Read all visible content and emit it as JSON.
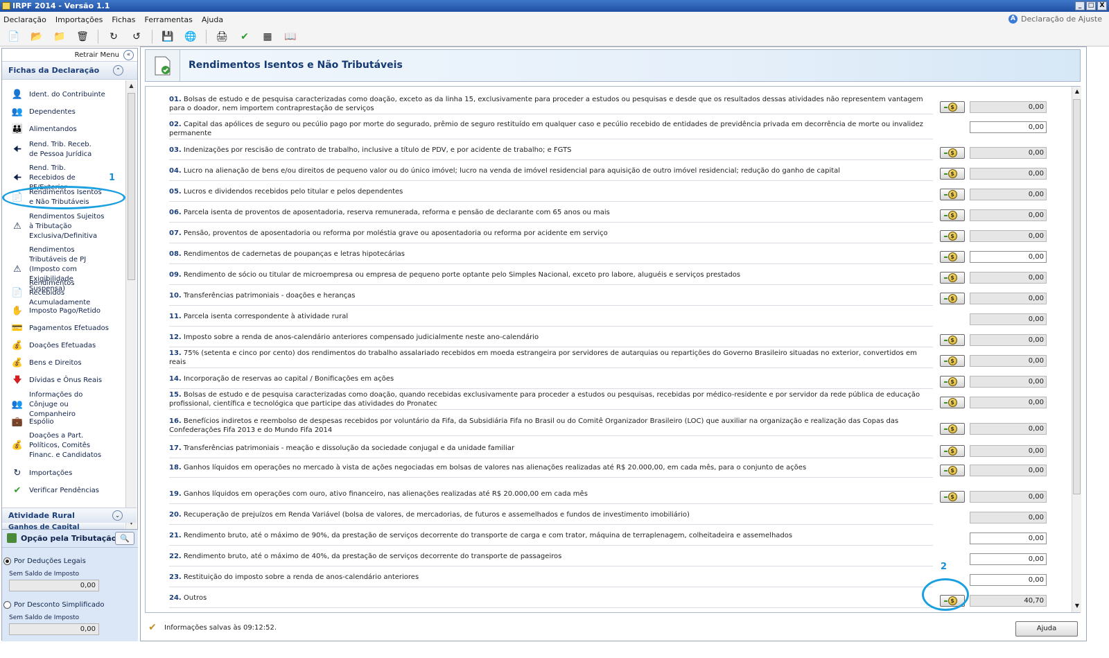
{
  "window": {
    "title": "IRPF 2014 - Versão 1.1",
    "buttons": [
      "_",
      "□",
      "X"
    ]
  },
  "menu": [
    "Declaração",
    "Importações",
    "Fichas",
    "Ferramentas",
    "Ajuda"
  ],
  "decl_type": "Declaração de Ajuste",
  "sidebar": {
    "retrair": "Retrair Menu",
    "fichas_title": "Fichas da Declaração",
    "items": [
      {
        "label": "Ident. do Contribuinte",
        "icon": "person-icon"
      },
      {
        "label": "Dependentes",
        "icon": "dependents-icon"
      },
      {
        "label": "Alimentandos",
        "icon": "alimentandos-icon"
      },
      {
        "label": "Rend. Trib. Receb. de Pessoa Jurídica",
        "icon": "income-pj-icon"
      },
      {
        "label": "Rend. Trib. Recebidos de PF/Exterior",
        "icon": "income-pf-icon"
      },
      {
        "label": "Rendimentos Isentos e Não Tributáveis",
        "icon": "exempt-income-icon"
      },
      {
        "label": "Rendimentos Sujeitos à Tributação Exclusiva/Definitiva",
        "icon": "exclusive-tax-icon"
      },
      {
        "label": "Rendimentos Tributáveis de PJ (Imposto com Exigibilidade Suspensa)",
        "icon": "suspended-tax-icon"
      },
      {
        "label": "Rendimentos Recebidos Acumuladamente",
        "icon": "accumulated-income-icon"
      },
      {
        "label": "Imposto Pago/Retido",
        "icon": "tax-paid-icon"
      },
      {
        "label": "Pagamentos Efetuados",
        "icon": "payments-icon"
      },
      {
        "label": "Doações Efetuadas",
        "icon": "donations-icon"
      },
      {
        "label": "Bens e Direitos",
        "icon": "assets-icon"
      },
      {
        "label": "Dívidas e Ônus Reais",
        "icon": "debts-icon"
      },
      {
        "label": "Informações do Cônjuge ou Companheiro",
        "icon": "spouse-icon"
      },
      {
        "label": "Espólio",
        "icon": "estate-icon"
      },
      {
        "label": "Doações a Part. Políticos, Comitês Financ. e Candidatos",
        "icon": "political-donations-icon"
      },
      {
        "label": "Importações",
        "icon": "import-icon"
      },
      {
        "label": "Verificar Pendências",
        "icon": "check-icon"
      }
    ],
    "atividade_rural": "Atividade Rural",
    "ganhos": "Ganhos de Capital",
    "opcao_title": "Opção pela Tributação:",
    "deducoes_label": "Por Deduções Legais",
    "deducoes_sub": "Sem Saldo de Imposto",
    "deducoes_value": "0,00",
    "simplificado_label": "Por Desconto Simplificado",
    "simplificado_sub": "Sem Saldo de Imposto",
    "simplificado_value": "0,00"
  },
  "main": {
    "title": "Rendimentos Isentos e Não Tributáveis",
    "rows": [
      {
        "num": "01.",
        "text": "Bolsas de estudo e de pesquisa caracterizadas como doação, exceto as da linha 15, exclusivamente para proceder a estudos ou pesquisas e desde que os resultados dessas atividades não representem vantagem para o doador, nem importem contraprestação de serviços",
        "btn": true,
        "value": "0,00",
        "editable": false
      },
      {
        "num": "02.",
        "text": "Capital das apólices de seguro ou pecúlio pago por morte do segurado, prêmio de seguro restituído em qualquer caso e pecúlio recebido de entidades de previdência privada em decorrência de morte ou invalidez permanente",
        "btn": false,
        "value": "0,00",
        "editable": true
      },
      {
        "num": "03.",
        "text": "Indenizações por rescisão de contrato de trabalho, inclusive a título de PDV, e por acidente de trabalho; e FGTS",
        "btn": true,
        "value": "0,00",
        "editable": false
      },
      {
        "num": "04.",
        "text": "Lucro na alienação de bens e/ou direitos de pequeno valor ou do único imóvel; lucro na venda de imóvel residencial para aquisição de outro imóvel residencial; redução do ganho de capital",
        "btn": true,
        "value": "0,00",
        "editable": false
      },
      {
        "num": "05.",
        "text": "Lucros e dividendos recebidos pelo titular e pelos dependentes",
        "btn": true,
        "value": "0,00",
        "editable": false
      },
      {
        "num": "06.",
        "text": "Parcela isenta de proventos de aposentadoria, reserva remunerada, reforma e pensão de declarante com 65 anos ou mais",
        "btn": true,
        "value": "0,00",
        "editable": false
      },
      {
        "num": "07.",
        "text": "Pensão, proventos de aposentadoria ou reforma por moléstia grave ou aposentadoria ou reforma por acidente em serviço",
        "btn": true,
        "value": "0,00",
        "editable": false
      },
      {
        "num": "08.",
        "text": "Rendimentos de cadernetas de poupanças e letras hipotecárias",
        "btn": true,
        "value": "0,00",
        "editable": true
      },
      {
        "num": "09.",
        "text": "Rendimento de sócio ou titular de microempresa ou empresa de pequeno porte optante pelo Simples Nacional, exceto pro labore, aluguéis e serviços prestados",
        "btn": true,
        "value": "0,00",
        "editable": false
      },
      {
        "num": "10.",
        "text": "Transferências patrimoniais - doações e heranças",
        "btn": true,
        "value": "0,00",
        "editable": false
      },
      {
        "num": "11.",
        "text": "Parcela isenta correspondente à atividade rural",
        "btn": false,
        "value": "0,00",
        "editable": false
      },
      {
        "num": "12.",
        "text": "Imposto sobre a renda de anos-calendário anteriores compensado judicialmente neste ano-calendário",
        "btn": true,
        "value": "0,00",
        "editable": false
      },
      {
        "num": "13.",
        "text": "75% (setenta e cinco por cento) dos rendimentos do trabalho assalariado recebidos em moeda estrangeira por servidores de autarquias ou repartições do Governo Brasileiro situadas no exterior, convertidos em reais",
        "btn": true,
        "value": "0,00",
        "editable": false
      },
      {
        "num": "14.",
        "text": "Incorporação de reservas ao capital / Bonificações em ações",
        "btn": true,
        "value": "0,00",
        "editable": false
      },
      {
        "num": "15.",
        "text": "Bolsas de estudo e de pesquisa caracterizadas como doação, quando recebidas exclusivamente para proceder a estudos ou pesquisas, recebidas por médico-residente e por servidor da rede pública de educação profissional, científica e tecnológica que participe das atividades do Pronatec",
        "btn": true,
        "value": "0,00",
        "editable": false
      },
      {
        "num": "16.",
        "text": "Benefícios indiretos e reembolso de despesas recebidos por voluntário da Fifa, da Subsidiária Fifa no Brasil ou do Comitê Organizador Brasileiro (LOC) que auxiliar na organização e realização das Copas das Confederações Fifa 2013 e do Mundo Fifa 2014",
        "btn": true,
        "value": "0,00",
        "editable": false
      },
      {
        "num": "17.",
        "text": "Transferências patrimoniais - meação e dissolução da sociedade conjugal e da unidade familiar",
        "btn": true,
        "value": "0,00",
        "editable": false
      },
      {
        "num": "18.",
        "text": "Ganhos líquidos em operações no mercado à vista de ações negociadas em bolsas de valores nas alienações realizadas até R$ 20.000,00, em cada mês, para o conjunto de ações",
        "btn": true,
        "value": "0,00",
        "editable": false
      },
      {
        "num": "19.",
        "text": "Ganhos líquidos em operações com ouro, ativo financeiro, nas alienações realizadas até R$ 20.000,00 em cada mês",
        "btn": true,
        "value": "0,00",
        "editable": false
      },
      {
        "num": "20.",
        "text": "Recuperação de prejuízos em Renda Variável (bolsa de valores, de mercadorias, de futuros e assemelhados e fundos de investimento imobiliário)",
        "btn": false,
        "value": "0,00",
        "editable": false
      },
      {
        "num": "21.",
        "text": "Rendimento bruto, até o máximo de 90%, da prestação de serviços decorrente do transporte de carga e com trator, máquina de terraplenagem, colheitadeira e assemelhados",
        "btn": false,
        "value": "0,00",
        "editable": true
      },
      {
        "num": "22.",
        "text": "Rendimento bruto, até o máximo de 40%, da prestação de serviços decorrente do transporte de passageiros",
        "btn": false,
        "value": "0,00",
        "editable": true
      },
      {
        "num": "23.",
        "text": "Restituição do imposto sobre a renda de anos-calendário anteriores",
        "btn": false,
        "value": "0,00",
        "editable": true
      },
      {
        "num": "24.",
        "text": "Outros",
        "btn": true,
        "value": "40,70",
        "editable": false
      }
    ]
  },
  "status": "Informações salvas às 09:12:52.",
  "help_button": "Ajuda",
  "annotations": [
    "1",
    "2"
  ]
}
